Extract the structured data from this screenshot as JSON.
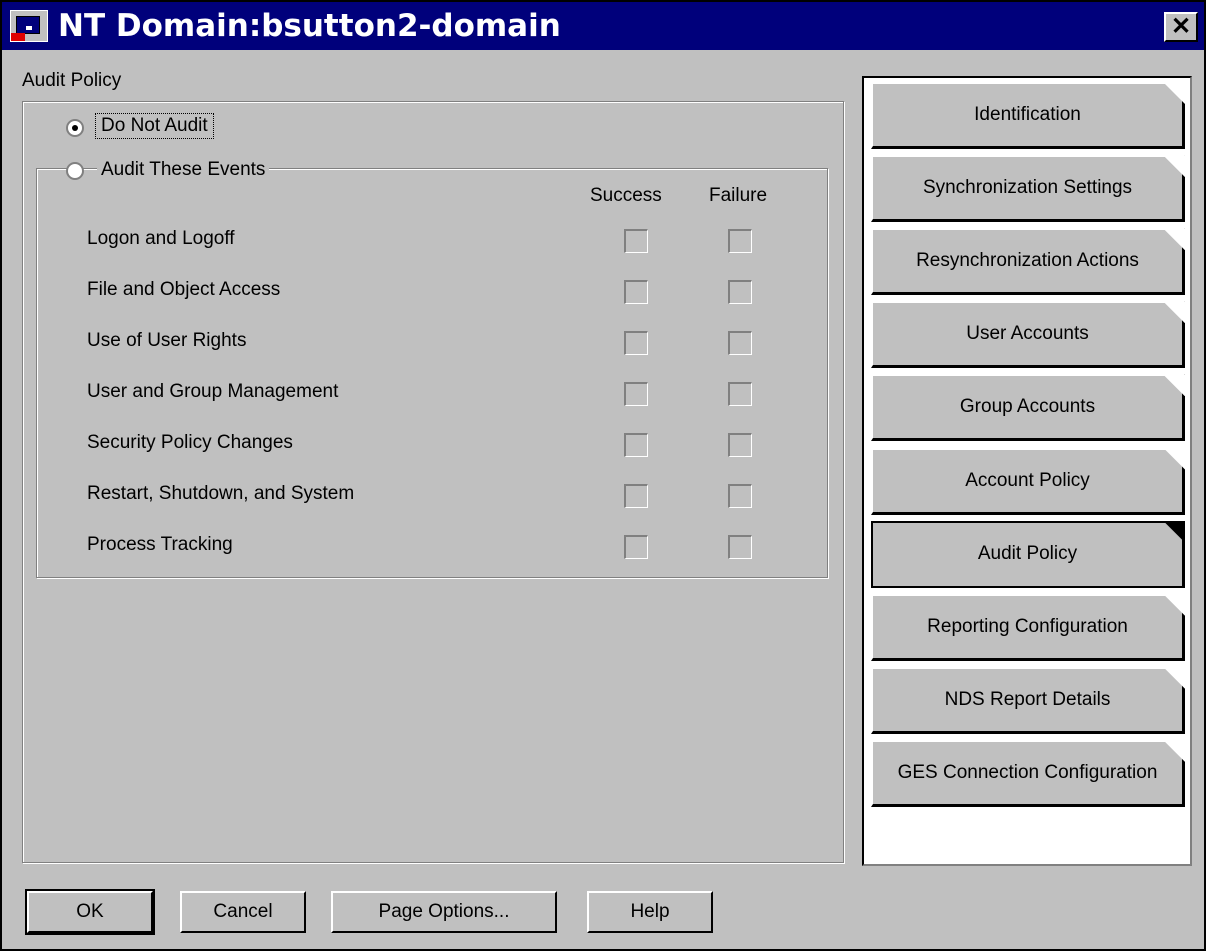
{
  "window": {
    "title": "NT Domain:bsutton2-domain",
    "close_label": "✕"
  },
  "audit": {
    "section_title": "Audit Policy",
    "do_not_audit_label": "Do Not Audit",
    "audit_these_events_label": "Audit These Events",
    "selected_option": "Do Not Audit",
    "success_header": "Success",
    "failure_header": "Failure",
    "events": [
      {
        "label": "Logon and Logoff",
        "success": false,
        "failure": false
      },
      {
        "label": "File and Object Access",
        "success": false,
        "failure": false
      },
      {
        "label": "Use of User Rights",
        "success": false,
        "failure": false
      },
      {
        "label": "User and Group Management",
        "success": false,
        "failure": false
      },
      {
        "label": "Security Policy Changes",
        "success": false,
        "failure": false
      },
      {
        "label": "Restart, Shutdown, and System",
        "success": false,
        "failure": false
      },
      {
        "label": "Process Tracking",
        "success": false,
        "failure": false
      }
    ]
  },
  "tabs": [
    {
      "label": "Identification"
    },
    {
      "label": "Synchronization Settings"
    },
    {
      "label": "Resynchronization Actions"
    },
    {
      "label": "User Accounts"
    },
    {
      "label": "Group Accounts"
    },
    {
      "label": "Account Policy"
    },
    {
      "label": "Audit Policy"
    },
    {
      "label": "Reporting Configuration"
    },
    {
      "label": "NDS Report Details"
    },
    {
      "label": "GES Connection Configuration"
    }
  ],
  "active_tab": "Audit Policy",
  "buttons": {
    "ok": "OK",
    "cancel": "Cancel",
    "page_options": "Page Options...",
    "help": "Help"
  }
}
